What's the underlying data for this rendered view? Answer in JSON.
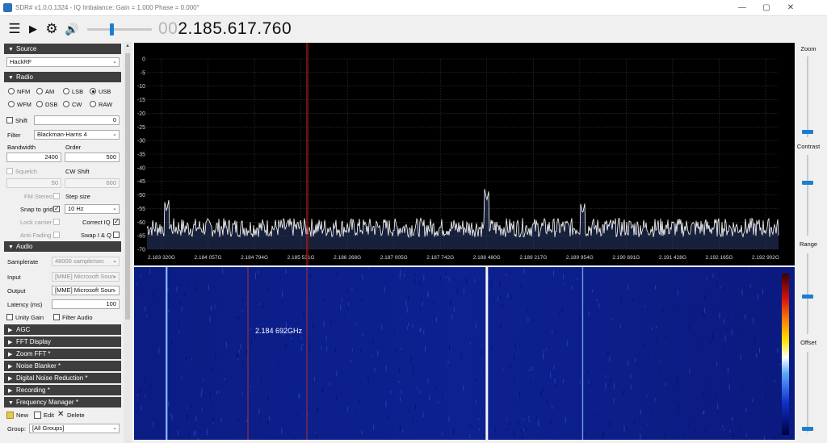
{
  "window": {
    "title": "SDR# v1.0.0.1324 - IQ Imbalance: Gain = 1.000 Phase = 0.000°",
    "minimize": "—",
    "maximize": "▢",
    "close": "✕"
  },
  "toolbar": {
    "volume_level": 0.38,
    "freq_prefix": "00",
    "frequency": "2.185.617.760"
  },
  "icons": {
    "menu": "☰",
    "play": "▶",
    "settings": "⚙",
    "volume": "🔊",
    "panel_open": "▼",
    "panel_closed": "▶",
    "dropdown": "⌄",
    "check": "✓",
    "scroll_up": "▲"
  },
  "panels": {
    "source": {
      "header": "Source",
      "device": "HackRF"
    },
    "radio": {
      "header": "Radio",
      "modes": [
        "NFM",
        "AM",
        "LSB",
        "USB",
        "WFM",
        "DSB",
        "CW",
        "RAW"
      ],
      "selected_mode": "USB",
      "shift_label": "Shift",
      "shift_value": "0",
      "filter_label": "Filter",
      "filter_value": "Blackman-Harris 4",
      "bandwidth_label": "Bandwidth",
      "bandwidth_value": "2400",
      "order_label": "Order",
      "order_value": "500",
      "squelch_label": "Squelch",
      "squelch_value": "50",
      "cw_shift_label": "CW Shift",
      "cw_shift_value": "600",
      "fm_stereo_label": "FM Stereo",
      "step_size_label": "Step size",
      "snap_label": "Snap to grid",
      "step_value": "10 Hz",
      "lock_carrier_label": "Lock carrier",
      "correct_iq_label": "Correct IQ",
      "anti_fading_label": "Anti-Fading",
      "swap_iq_label": "Swap I & Q"
    },
    "audio": {
      "header": "Audio",
      "samplerate_label": "Samplerate",
      "samplerate_value": "48000 sample/sec",
      "input_label": "Input",
      "input_value": "[MME] Microsoft Soun",
      "output_label": "Output",
      "output_value": "[MME] Microsoft Soun",
      "latency_label": "Latency (ms)",
      "latency_value": "100",
      "unity_gain_label": "Unity Gain",
      "filter_audio_label": "Filter Audio"
    },
    "collapsed": [
      "AGC",
      "FFT Display",
      "Zoom FFT *",
      "Noise Blanker *",
      "Digital Noise Reduction *",
      "Recording *"
    ],
    "frequency_manager": {
      "header": "Frequency Manager *",
      "new_label": "New",
      "edit_label": "Edit",
      "delete_label": "Delete",
      "group_label": "Group:",
      "group_value": "[All Groups]"
    }
  },
  "spectrum": {
    "y_ticks": [
      "0",
      "-5",
      "-10",
      "-15",
      "-20",
      "-25",
      "-30",
      "-35",
      "-40",
      "-45",
      "-50",
      "-55",
      "-60",
      "-65",
      "-70"
    ],
    "x_ticks": [
      "2.183 320G",
      "2.184 057G",
      "2.184 794G",
      "2.185 531G",
      "2.186 268G",
      "2.187 005G",
      "2.187 742G",
      "2.188 480G",
      "2.189 217G",
      "2.189 954G",
      "2.190 691G",
      "2.191 428G",
      "2.192 165G",
      "2.192 902G"
    ],
    "noise_floor_db": -62,
    "peaks": [
      {
        "freq_ghz": 2.1834,
        "db": -56
      },
      {
        "freq_ghz": 2.18848,
        "db": -52
      },
      {
        "freq_ghz": 2.19,
        "db": -57
      }
    ]
  },
  "waterfall": {
    "cursor_label": "2.184 692GHz"
  },
  "right": {
    "zoom_label": "Zoom",
    "contrast_label": "Contrast",
    "range_label": "Range",
    "offset_label": "Offset"
  }
}
